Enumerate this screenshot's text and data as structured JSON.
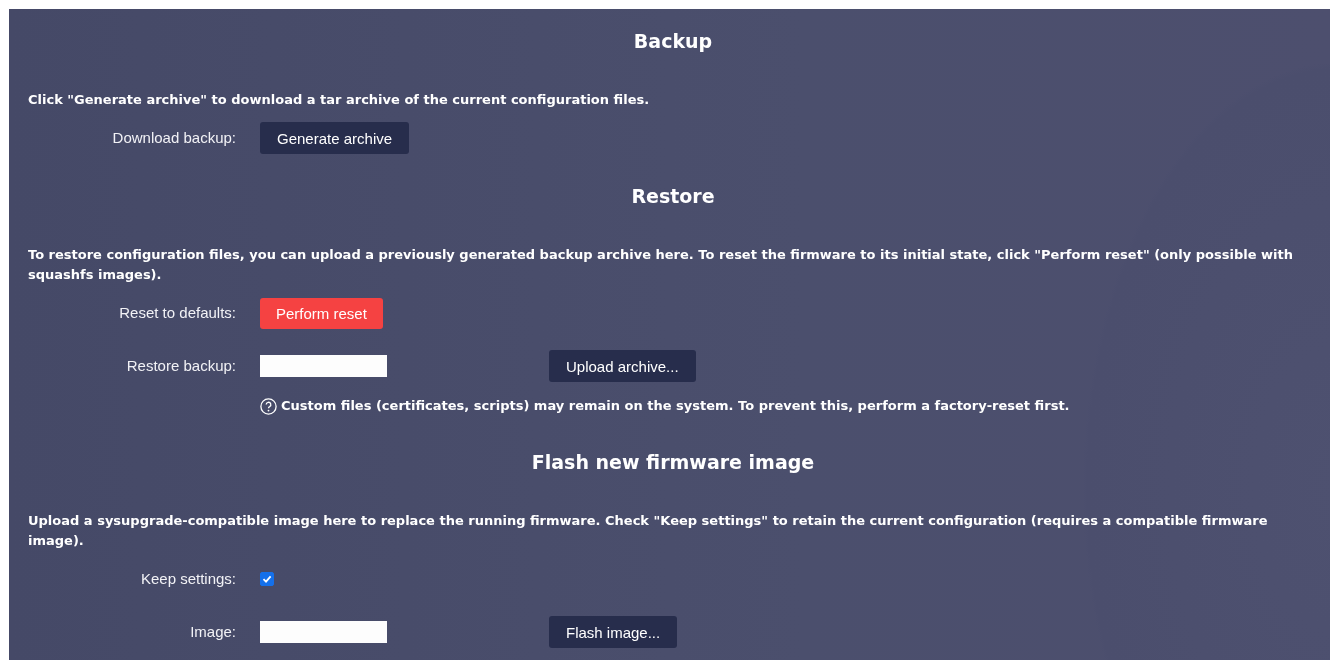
{
  "sections": [
    {
      "title": "Backup",
      "description": "Click \"Generate archive\" to download a tar archive of the current configuration files.",
      "rows": [
        {
          "kind": "button",
          "label": "Download backup:",
          "button": "Generate archive",
          "danger": false
        }
      ]
    },
    {
      "title": "Restore",
      "description": "To restore configuration files, you can upload a previously generated backup archive here. To reset the firmware to its initial state, click \"Perform reset\" (only possible with squashfs images).",
      "rows": [
        {
          "kind": "button",
          "label": "Reset to defaults:",
          "button": "Perform reset",
          "danger": true
        },
        {
          "kind": "file",
          "label": "Restore backup:",
          "button": "Upload archive..."
        }
      ],
      "note": "Custom files (certificates, scripts) may remain on the system. To prevent this, perform a factory-reset first."
    },
    {
      "title": "Flash new firmware image",
      "description": "Upload a sysupgrade-compatible image here to replace the running firmware. Check \"Keep settings\" to retain the current configuration (requires a compatible firmware image).",
      "rows": [
        {
          "kind": "checkbox",
          "label": "Keep settings:",
          "checked": true
        },
        {
          "kind": "file",
          "label": "Image:",
          "button": "Flash image..."
        }
      ]
    }
  ]
}
